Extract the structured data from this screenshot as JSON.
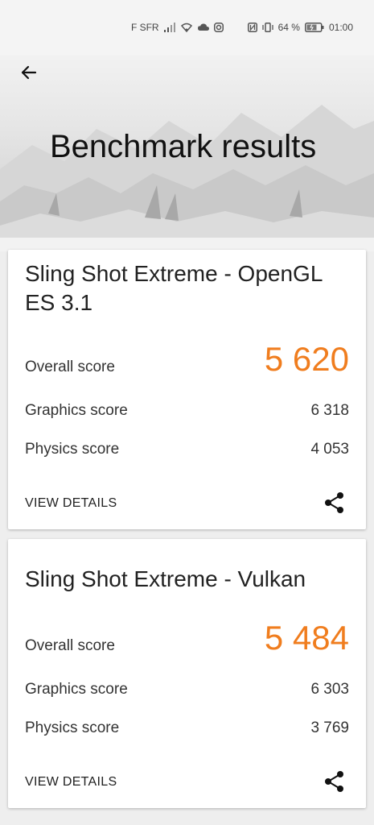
{
  "status_bar": {
    "carrier": "F SFR",
    "battery_percent": "64 %",
    "time": "01:00",
    "icons": [
      "signal-icon",
      "wifi-icon",
      "cloud-icon",
      "instagram-icon",
      "nfc-icon",
      "vibrate-icon",
      "battery-icon"
    ]
  },
  "header": {
    "title": "Benchmark results",
    "back_icon": "arrow-left-icon"
  },
  "results": [
    {
      "test_name": "Sling Shot Extreme - OpenGL ES 3.1",
      "overall_label": "Overall score",
      "overall_value": "5 620",
      "graphics_label": "Graphics score",
      "graphics_value": "6 318",
      "physics_label": "Physics score",
      "physics_value": "4 053",
      "view_details_label": "VIEW DETAILS",
      "share_icon": "share-icon"
    },
    {
      "test_name": "Sling Shot Extreme - Vulkan",
      "overall_label": "Overall score",
      "overall_value": "5 484",
      "graphics_label": "Graphics score",
      "graphics_value": "6 303",
      "physics_label": "Physics score",
      "physics_value": "3 769",
      "view_details_label": "VIEW DETAILS",
      "share_icon": "share-icon"
    }
  ],
  "colors": {
    "accent": "#f07d1e",
    "card_background": "#ffffff",
    "page_background": "#eeeeee"
  }
}
